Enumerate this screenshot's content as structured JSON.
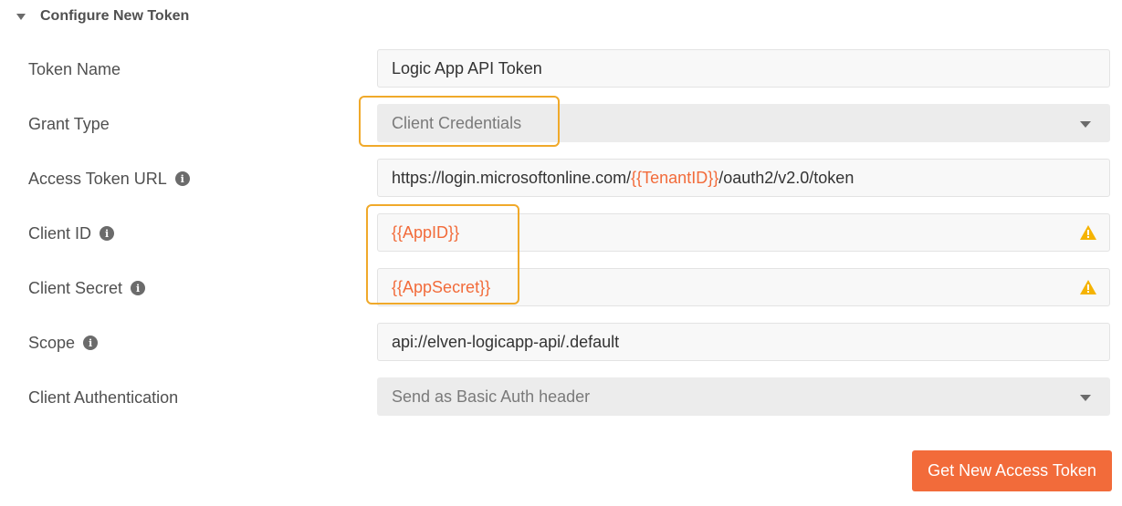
{
  "section": {
    "title": "Configure New Token"
  },
  "form": {
    "token_name": {
      "label": "Token Name",
      "value": "Logic App API Token"
    },
    "grant_type": {
      "label": "Grant Type",
      "value": "Client Credentials"
    },
    "access_token_url": {
      "label": "Access Token URL",
      "prefix": "https://login.microsoftonline.com/",
      "variable": "{{TenantID}}",
      "suffix": "/oauth2/v2.0/token"
    },
    "client_id": {
      "label": "Client ID",
      "value": "{{AppID}}"
    },
    "client_secret": {
      "label": "Client Secret",
      "value": "{{AppSecret}}"
    },
    "scope": {
      "label": "Scope",
      "value": "api://elven-logicapp-api/.default"
    },
    "client_authentication": {
      "label": "Client Authentication",
      "value": "Send as Basic Auth header"
    }
  },
  "actions": {
    "get_token_label": "Get New Access Token"
  },
  "icons": {
    "info": "i"
  },
  "colors": {
    "accent": "#f26b3a",
    "highlight": "#f0a92a",
    "warning": "#f5b301"
  }
}
